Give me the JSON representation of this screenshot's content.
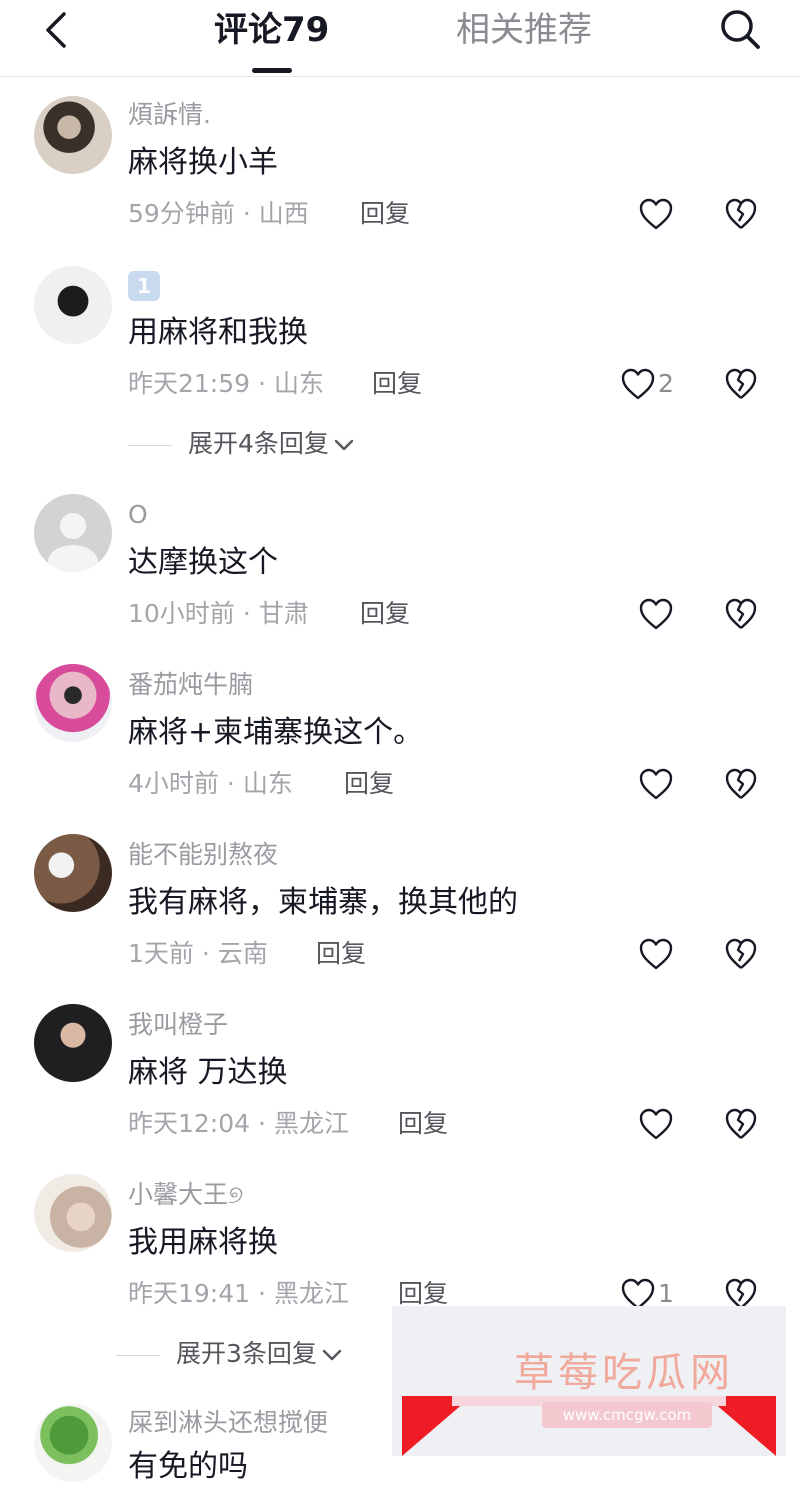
{
  "header": {
    "tab_comments": "评论79",
    "tab_related": "相关推荐"
  },
  "comments": [
    {
      "username": "煩訴情.",
      "text": "麻将换小羊",
      "time": "59分钟前",
      "location": "山西",
      "reply": "回复",
      "likes": ""
    },
    {
      "username": "",
      "badge": "1",
      "text": "用麻将和我换",
      "time": "昨天21:59",
      "location": "山东",
      "reply": "回复",
      "likes": "2",
      "expand": "展开4条回复"
    },
    {
      "username": "O",
      "text": "达摩换这个",
      "time": "10小时前",
      "location": "甘肃",
      "reply": "回复",
      "likes": ""
    },
    {
      "username": "番茄炖牛腩",
      "text": "麻将+柬埔寨换这个。",
      "time": "4小时前",
      "location": "山东",
      "reply": "回复",
      "likes": ""
    },
    {
      "username": "能不能别熬夜",
      "text": "我有麻将，柬埔寨，换其他的",
      "time": "1天前",
      "location": "云南",
      "reply": "回复",
      "likes": ""
    },
    {
      "username": "我叫橙子",
      "text": "麻将 万达换",
      "time": "昨天12:04",
      "location": "黑龙江",
      "reply": "回复",
      "likes": ""
    },
    {
      "username": "小馨大王୭",
      "text": "我用麻将换",
      "time": "昨天19:41",
      "location": "黑龙江",
      "reply": "回复",
      "likes": "1",
      "expand": "展开3条回复"
    },
    {
      "username": "屎到淋头还想搅便",
      "text": "有免的吗"
    }
  ],
  "watermark": {
    "title": "草莓吃瓜网",
    "url": "www.cmcgw.com"
  },
  "icons": {
    "back": "chevron-left-icon",
    "search": "search-icon",
    "like": "heart-outline-icon",
    "dislike": "broken-heart-icon",
    "expand": "chevron-down-icon"
  },
  "colors": {
    "text_primary": "#161823",
    "text_secondary": "#9a9ba1",
    "divider": "#e8e8ea"
  }
}
